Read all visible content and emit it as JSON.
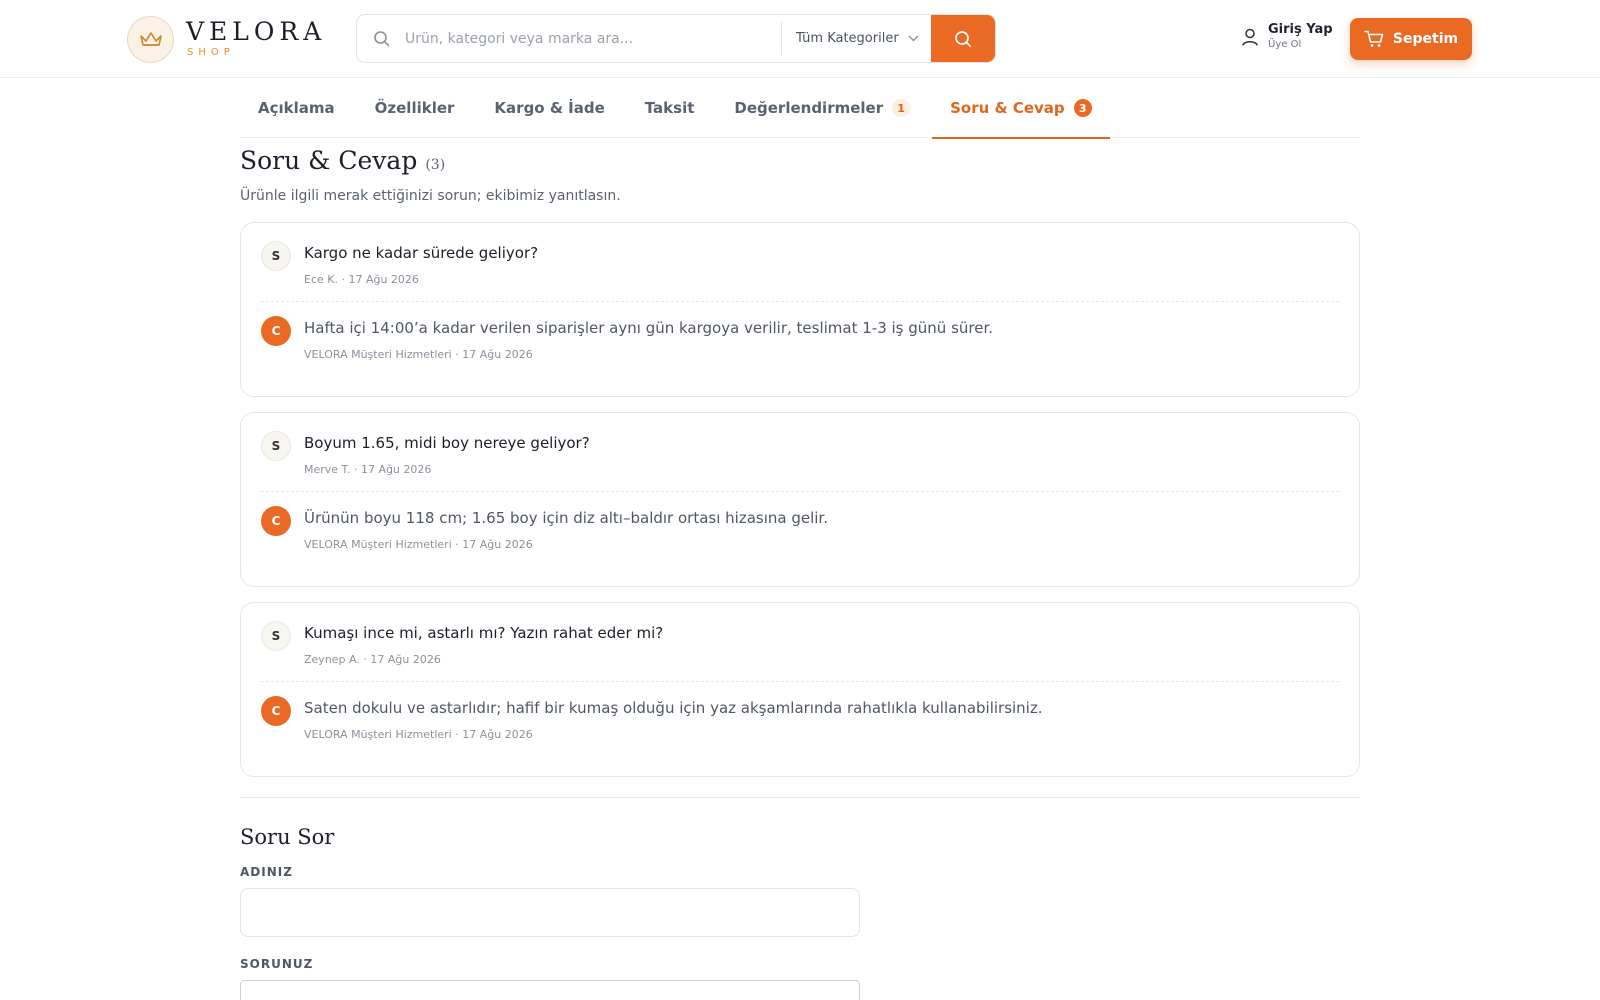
{
  "header": {
    "logo": {
      "name": "VELORA",
      "sub": "SHOP"
    },
    "search": {
      "placeholder": "Ürün, kategori veya marka ara...",
      "category": "Tüm Kategoriler"
    },
    "login": {
      "title": "Giriş Yap",
      "sub": "Üye Ol"
    },
    "cart_label": "Sepetim"
  },
  "tabs": [
    {
      "label": "Açıklama"
    },
    {
      "label": "Özellikler"
    },
    {
      "label": "Kargo & İade"
    },
    {
      "label": "Taksit"
    },
    {
      "label": "Değerlendirmeler",
      "badge": "1"
    },
    {
      "label": "Soru & Cevap",
      "badge": "3",
      "active": true
    }
  ],
  "qa_section": {
    "title": "Soru & Cevap",
    "count": "(3)",
    "subtitle": "Ürünle ilgili merak ettiğinizi sorun; ekibimiz yanıtlasın.",
    "question_avatar": "S",
    "answer_avatar": "C",
    "items": [
      {
        "question": "Kargo ne kadar sürede geliyor?",
        "question_meta": "Ece K. · 17 Ağu 2026",
        "answer": "Hafta içi 14:00’a kadar verilen siparişler aynı gün kargoya verilir, teslimat 1-3 iş günü sürer.",
        "answer_meta": "VELORA Müşteri Hizmetleri · 17 Ağu 2026"
      },
      {
        "question": "Boyum 1.65, midi boy nereye geliyor?",
        "question_meta": "Merve T. · 17 Ağu 2026",
        "answer": "Ürünün boyu 118 cm; 1.65 boy için diz altı–baldır ortası hizasına gelir.",
        "answer_meta": "VELORA Müşteri Hizmetleri · 17 Ağu 2026"
      },
      {
        "question": "Kumaşı ince mi, astarlı mı? Yazın rahat eder mi?",
        "question_meta": "Zeynep A. · 17 Ağu 2026",
        "answer": "Saten dokulu ve astarlıdır; hafif bir kumaş olduğu için yaz akşamlarında rahatlıkla kullanabilirsiniz.",
        "answer_meta": "VELORA Müşteri Hizmetleri · 17 Ağu 2026"
      }
    ]
  },
  "ask_form": {
    "title": "Soru Sor",
    "name_label": "ADINIZ",
    "question_label": "SORUNUZ"
  },
  "colors": {
    "accent": "#ea6a24",
    "gold": "#e0912f"
  }
}
